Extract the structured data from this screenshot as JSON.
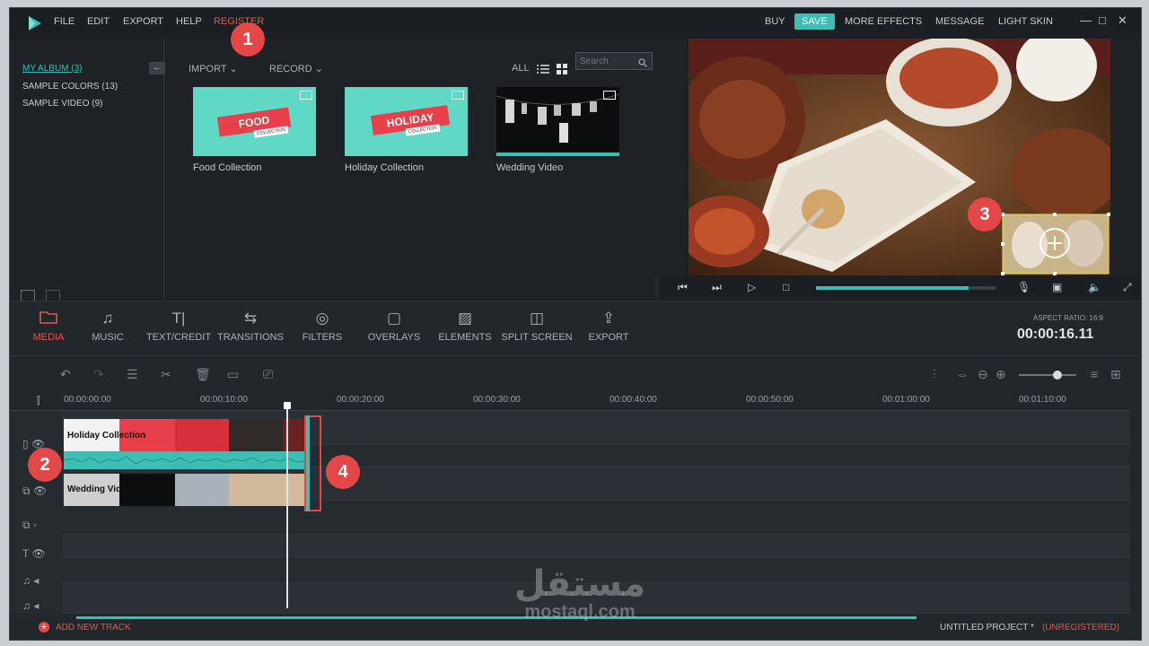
{
  "menu": {
    "file": "FILE",
    "edit": "EDIT",
    "export": "EXPORT",
    "help": "HELP",
    "register": "REGISTER"
  },
  "top_right": {
    "buy": "BUY",
    "save": "SAVE",
    "more_effects": "MORE EFFECTS",
    "message": "MESSAGE",
    "light_skin": "LIGHT SKIN"
  },
  "window": {
    "minimize": "—",
    "maximize": "□",
    "close": "✕"
  },
  "library": {
    "albums": [
      {
        "label": "MY ALBUM (3)"
      },
      {
        "label": "SAMPLE COLORS (13)"
      },
      {
        "label": "SAMPLE VIDEO (9)"
      }
    ],
    "import": "IMPORT",
    "record": "RECORD",
    "all": "ALL",
    "search_placeholder": "Search",
    "items": [
      {
        "label": "Food Collection",
        "art_line1": "FOOD",
        "art_line2": "COLLECTION"
      },
      {
        "label": "Holiday Collection",
        "art_line1": "HOLIDAY",
        "art_line2": "COLLECTION"
      },
      {
        "label": "Wedding Video"
      }
    ]
  },
  "tools": [
    {
      "label": "MEDIA",
      "icon": "folder-icon"
    },
    {
      "label": "MUSIC",
      "icon": "music-icon"
    },
    {
      "label": "TEXT/CREDIT",
      "icon": "text-icon"
    },
    {
      "label": "TRANSITIONS",
      "icon": "transitions-icon"
    },
    {
      "label": "FILTERS",
      "icon": "filters-icon"
    },
    {
      "label": "OVERLAYS",
      "icon": "overlays-icon"
    },
    {
      "label": "ELEMENTS",
      "icon": "elements-icon"
    },
    {
      "label": "SPLIT SCREEN",
      "icon": "split-screen-icon"
    },
    {
      "label": "EXPORT",
      "icon": "export-icon"
    }
  ],
  "aspect_ratio": "ASPECT RATIO: 16:9",
  "timecode": "00:00:16.11",
  "ruler_ticks": [
    "00:00:00:00",
    "00:00:10:00",
    "00:00:20:00",
    "00:00:30:00",
    "00:00:40:00",
    "00:00:50:00",
    "00:01:00:00",
    "00:01:10:00"
  ],
  "clips": {
    "video1": "Holiday Collection",
    "video2": "Wedding Video"
  },
  "badges": [
    "1",
    "2",
    "3",
    "4"
  ],
  "add_track": "ADD NEW TRACK",
  "project_name": "UNTITLED PROJECT *",
  "registration": "(UNREGISTERED)",
  "watermark": {
    "arabic": "مستقل",
    "latin": "mostaql.com"
  },
  "colors": {
    "accent": "#3bbfb4",
    "highlight": "#e15a4a",
    "badge": "#e34747"
  },
  "progress": {
    "playback_fraction": 0.85
  }
}
